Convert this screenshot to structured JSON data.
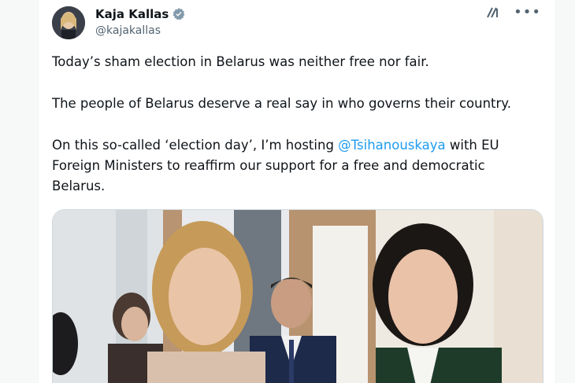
{
  "author": {
    "name": "Kaja Kallas",
    "handle": "@kajakallas"
  },
  "tweet": {
    "para1": "Today’s sham election in Belarus was neither free nor fair.",
    "para2": "The people of Belarus deserve a real say in who governs their country.",
    "para3_before": "On this so-called ‘election day’, I’m hosting ",
    "mention": "@Tsihanouskaya",
    "para3_after": " with EU Foreign Ministers to reaffirm our support for a free and democratic Belarus."
  },
  "icons": {
    "verified": "verified-badge-icon",
    "grok": "grok-icon",
    "more": "more-icon"
  },
  "colors": {
    "accent": "#1d9bf0",
    "text": "#0f1419",
    "muted": "#536471"
  },
  "media": {
    "alt": "Photo: two women walking in a corridor with a man in a suit behind them"
  }
}
